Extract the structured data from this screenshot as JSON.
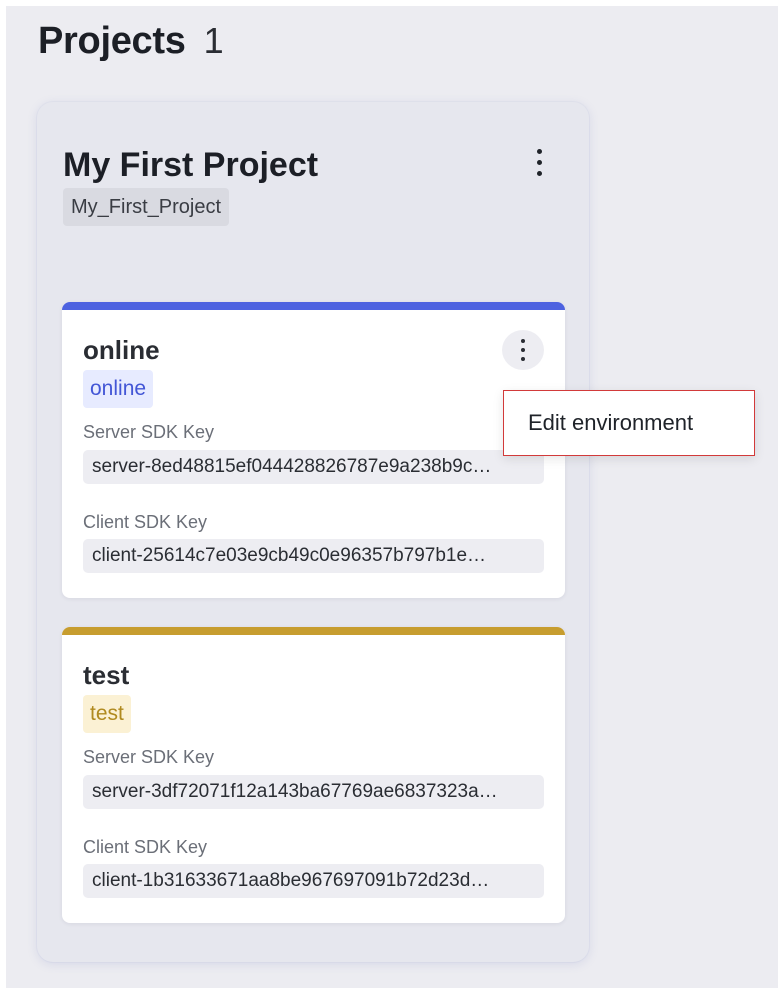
{
  "header": {
    "title": "Projects",
    "count": "1"
  },
  "project": {
    "name": "My First Project",
    "key": "My_First_Project",
    "environments": [
      {
        "name": "online",
        "tag": "online",
        "color": "#4d62e0",
        "server_label": "Server SDK Key",
        "server_key": "server-8ed48815ef044428826787e9a238b9c…",
        "client_label": "Client SDK Key",
        "client_key": "client-25614c7e03e9cb49c0e96357b797b1e…"
      },
      {
        "name": "test",
        "tag": "test",
        "color": "#c79d2f",
        "server_label": "Server SDK Key",
        "server_key": "server-3df72071f12a143ba67769ae6837323a…",
        "client_label": "Client SDK Key",
        "client_key": "client-1b31633671aa8be967697091b72d23d…"
      }
    ]
  },
  "menu": {
    "items": [
      "Edit environment"
    ]
  },
  "icons": {
    "more": "more-vertical-icon"
  }
}
